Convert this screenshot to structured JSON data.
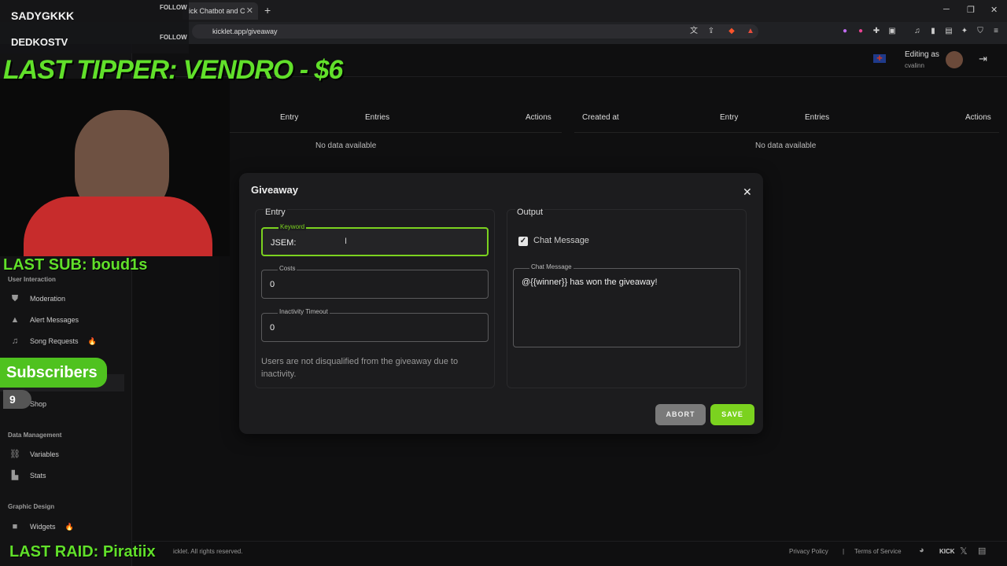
{
  "browser": {
    "tab_title": "ick Chatbot and C",
    "url": "kicklet.app/giveaway"
  },
  "header": {
    "editing_as_label": "Editing as",
    "editing_user": "cvalinn"
  },
  "tables": {
    "left": {
      "headers": [
        "Entry",
        "Entries",
        "Actions"
      ],
      "empty": "No data available"
    },
    "right": {
      "headers": [
        "Created at",
        "Entry",
        "Entries",
        "Actions"
      ],
      "empty": "No data available"
    }
  },
  "sidebar": {
    "sections": [
      {
        "title": "User Interaction",
        "items": [
          "Moderation",
          "Alert Messages",
          "Song Requests",
          "Shop"
        ]
      },
      {
        "title": "Data Management",
        "items": [
          "Variables",
          "Stats"
        ]
      },
      {
        "title": "Graphic Design",
        "items": [
          "Widgets"
        ]
      }
    ]
  },
  "modal": {
    "title": "Giveaway",
    "entry": {
      "title": "Entry",
      "keyword_label": "Keyword",
      "keyword_value": "JSEM:",
      "costs_label": "Costs",
      "costs_value": "0",
      "inactivity_label": "Inactivity Timeout",
      "inactivity_value": "0",
      "note": "Users are not disqualified from the giveaway due to inactivity."
    },
    "output": {
      "title": "Output",
      "checkbox_label": "Chat Message",
      "checked": true,
      "message_label": "Chat Message",
      "message_value": "@{{winner}} has won the giveaway!"
    },
    "abort_label": "ABORT",
    "save_label": "SAVE"
  },
  "footer": {
    "copyright": "icklet. All rights reserved.",
    "privacy": "Privacy Policy",
    "separator": "|",
    "terms": "Terms of Service",
    "kick": "KICK"
  },
  "overlay": {
    "follower1": "SADYGKKK",
    "follower2": "DEDKOSTV",
    "follow_label": "FOLLOW",
    "last_tipper": "LAST TIPPER: VENDRO - $6",
    "last_sub": "LAST SUB: boud1s",
    "subscribers_label": "Subscribers",
    "subscribers_count": "9",
    "last_raid": "LAST RAID: Piratiix"
  },
  "colors": {
    "accent": "#7bd21f",
    "overlay_green": "#61e02a",
    "abort": "#7a7a7a"
  }
}
